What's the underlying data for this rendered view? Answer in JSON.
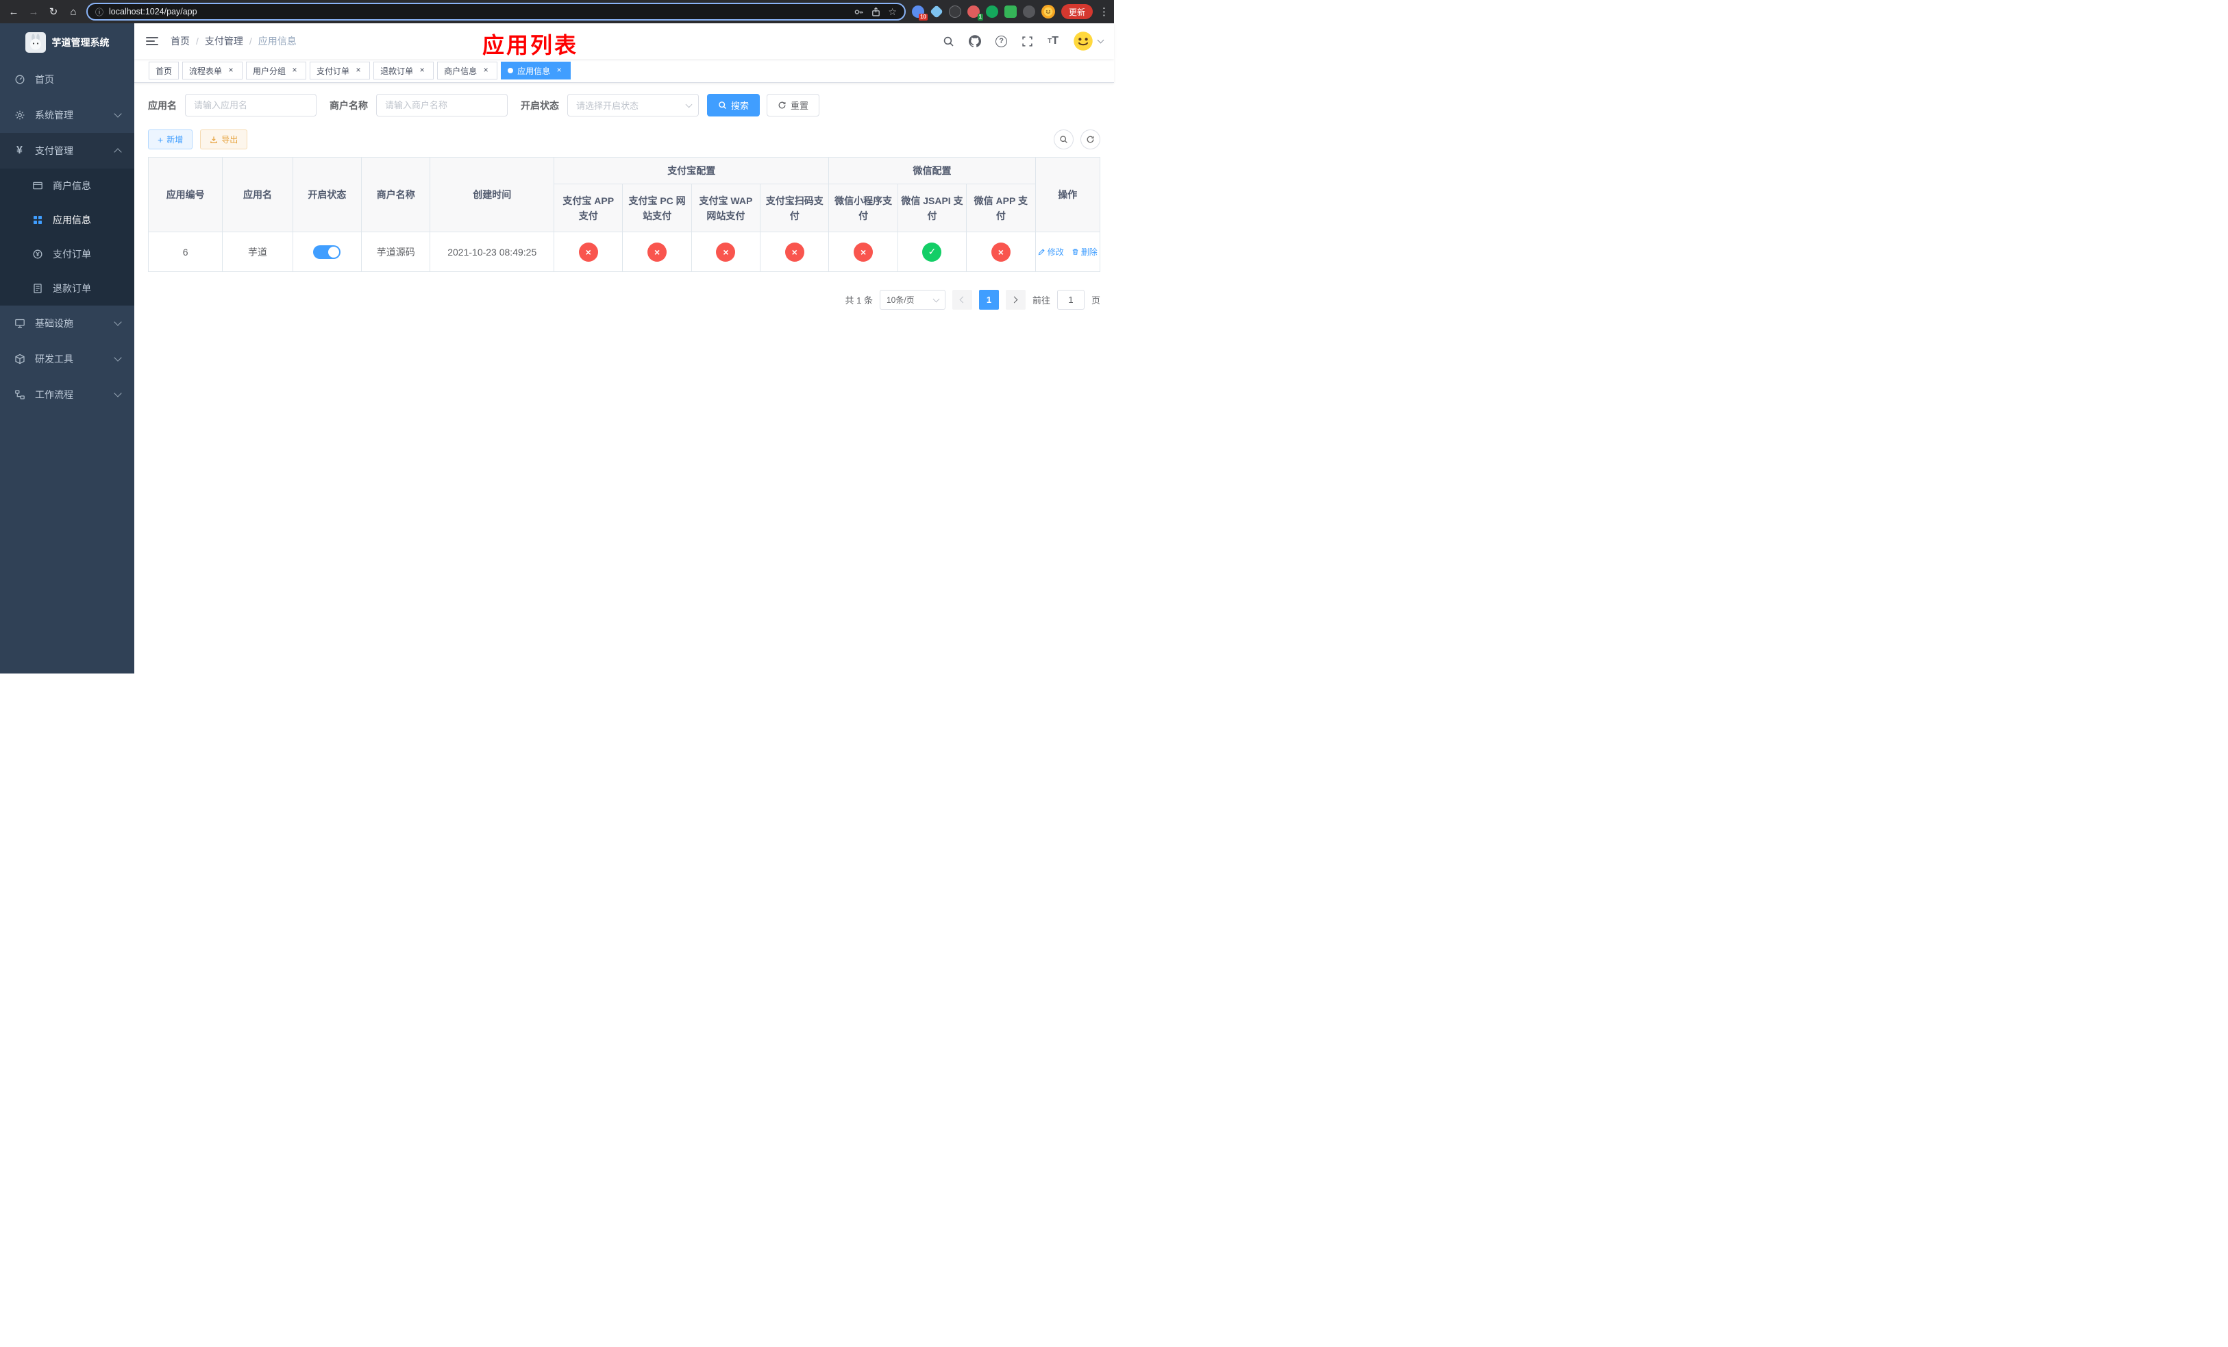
{
  "colors": {
    "accent": "#409EFF",
    "success": "#13ce66",
    "danger": "#f9554e",
    "warning": "#e6a23c",
    "title_red": "#fe0000",
    "sidebar_bg": "#304156",
    "submenu_bg": "#1f2d3d"
  },
  "icons": {
    "back": "←",
    "forward": "→",
    "reload": "↻",
    "home": "⌂",
    "info": "ⓘ",
    "star": "☆",
    "more": "⋮",
    "close": "×",
    "check": "✓",
    "cross": "×",
    "plus": "+",
    "question": "?",
    "text_small": "T",
    "text_large": "T",
    "yen": "¥"
  },
  "browser": {
    "url": "localhost:1024/pay/app",
    "update_button": "更新",
    "extension_badge_1": "10",
    "extension_badge_2": "1"
  },
  "sidebar": {
    "title": "芋道管理系统",
    "items": [
      {
        "label": "首页"
      },
      {
        "label": "系统管理"
      },
      {
        "label": "支付管理"
      },
      {
        "label": "基础设施"
      },
      {
        "label": "研发工具"
      },
      {
        "label": "工作流程"
      }
    ],
    "payment_children": [
      {
        "label": "商户信息"
      },
      {
        "label": "应用信息"
      },
      {
        "label": "支付订单"
      },
      {
        "label": "退款订单"
      }
    ]
  },
  "header": {
    "breadcrumb": [
      "首页",
      "支付管理",
      "应用信息"
    ],
    "page_title": "应用列表"
  },
  "tabs": [
    {
      "label": "首页"
    },
    {
      "label": "流程表单"
    },
    {
      "label": "用户分组"
    },
    {
      "label": "支付订单"
    },
    {
      "label": "退款订单"
    },
    {
      "label": "商户信息"
    },
    {
      "label": "应用信息"
    }
  ],
  "filters": {
    "app_name_label": "应用名",
    "app_name_placeholder": "请输入应用名",
    "merchant_label": "商户名称",
    "merchant_placeholder": "请输入商户名称",
    "status_label": "开启状态",
    "status_placeholder": "请选择开启状态",
    "search_label": "搜索",
    "reset_label": "重置"
  },
  "toolbar": {
    "add_label": "新增",
    "export_label": "导出"
  },
  "table": {
    "col_app_id": "应用编号",
    "col_app_name": "应用名",
    "col_status": "开启状态",
    "col_merchant": "商户名称",
    "col_created": "创建时间",
    "group_alipay": "支付宝配置",
    "group_wechat": "微信配置",
    "col_alipay_app": "支付宝 APP 支付",
    "col_alipay_pc": "支付宝 PC 网站支付",
    "col_alipay_wap": "支付宝 WAP 网站支付",
    "col_alipay_scan": "支付宝扫码支付",
    "col_wx_mini": "微信小程序支付",
    "col_wx_jsapi": "微信 JSAPI 支付",
    "col_wx_app": "微信 APP 支付",
    "col_actions": "操作",
    "rows": [
      {
        "app_id": "6",
        "app_name": "芋道",
        "status_on": true,
        "merchant": "芋道源码",
        "created": "2021-10-23 08:49:25",
        "config": {
          "alipay_app": false,
          "alipay_pc": false,
          "alipay_wap": false,
          "alipay_scan": false,
          "wx_mini": false,
          "wx_jsapi": true,
          "wx_app": false
        },
        "edit_label": "修改",
        "delete_label": "删除"
      }
    ]
  },
  "pagination": {
    "total_label": "共 1 条",
    "page_size": "10条/页",
    "current_page": "1",
    "goto_label": "前往",
    "goto_value": "1",
    "page_suffix": "页"
  }
}
